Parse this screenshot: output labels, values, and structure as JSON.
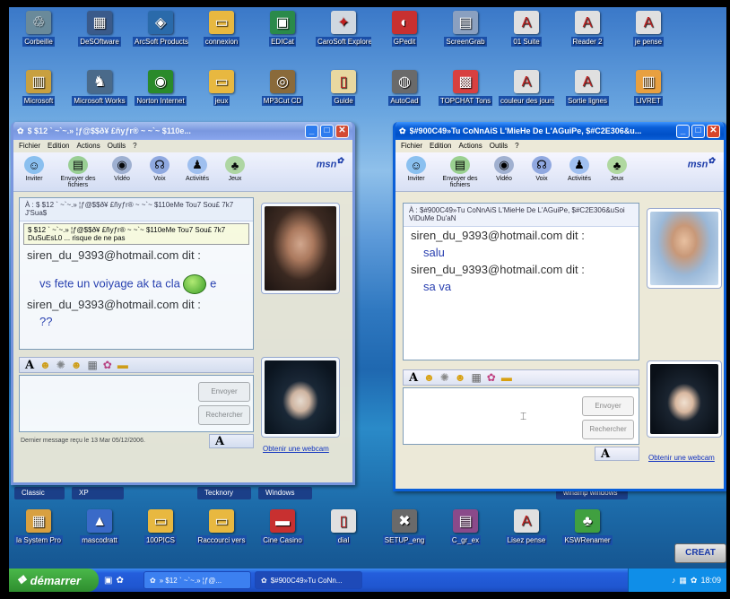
{
  "desktop": {
    "row1": [
      {
        "label": "Corbeille",
        "icon": "recycle-bin-icon",
        "color": "#6a8a9a",
        "glyph": "♲"
      },
      {
        "label": "DeSOftware",
        "icon": "software-icon",
        "color": "#3a5a8a",
        "glyph": "▦"
      },
      {
        "label": "ArcSoft Products",
        "icon": "arcsoft-icon",
        "color": "#2a6aaa",
        "glyph": "◈"
      },
      {
        "label": "connexion",
        "icon": "folder-icon",
        "color": "#e8b840",
        "glyph": "▭"
      },
      {
        "label": "EDICat",
        "icon": "app-icon",
        "color": "#2a8a4a",
        "glyph": "▣"
      },
      {
        "label": "CaroSoft Explorer",
        "icon": "explorer-icon",
        "color": "#d0d8e0",
        "glyph": "✦"
      },
      {
        "label": "GPedit",
        "icon": "gpedit-icon",
        "color": "#c83030",
        "glyph": "◐"
      },
      {
        "label": "ScreenGrab",
        "icon": "screengrab-icon",
        "color": "#8aa0c0",
        "glyph": "▤"
      },
      {
        "label": "01 Suite",
        "icon": "pdf-icon",
        "color": "#e0e0e0",
        "glyph": "A"
      },
      {
        "label": "Reader 2",
        "icon": "pdf-icon",
        "color": "#e0e0e0",
        "glyph": "A"
      },
      {
        "label": "je pense",
        "icon": "pdf-icon",
        "color": "#e0e0e0",
        "glyph": "A"
      }
    ],
    "row2": [
      {
        "label": "Microsoft",
        "icon": "word-icon",
        "color": "#c8a040",
        "glyph": "▥"
      },
      {
        "label": "Microsoft Works",
        "icon": "works-icon",
        "color": "#4a6a8a",
        "glyph": "♞"
      },
      {
        "label": "Norton Internet",
        "icon": "norton-icon",
        "color": "#2a8a2a",
        "glyph": "◉"
      },
      {
        "label": "jeux",
        "icon": "folder-icon",
        "color": "#e8b840",
        "glyph": "▭"
      },
      {
        "label": "MP3Cut CD",
        "icon": "cd-icon",
        "color": "#8a6a3a",
        "glyph": "◎"
      },
      {
        "label": "Guide",
        "icon": "document-icon",
        "color": "#e8d8a0",
        "glyph": "▯"
      },
      {
        "label": "AutoCad",
        "icon": "autocad-icon",
        "color": "#6a6a6a",
        "glyph": "◍"
      },
      {
        "label": "TOPCHAT Tons",
        "icon": "chat-icon",
        "color": "#d84040",
        "glyph": "▩"
      },
      {
        "label": "couleur des jours",
        "icon": "pdf-icon",
        "color": "#e0e0e0",
        "glyph": "A"
      },
      {
        "label": "Sortie lignes",
        "icon": "pdf-icon",
        "color": "#e0e0e0",
        "glyph": "A"
      },
      {
        "label": "LIVRET",
        "icon": "book-icon",
        "color": "#e8a040",
        "glyph": "▥"
      }
    ],
    "bottom_row": [
      {
        "label": "la System Pro",
        "icon": "system-icon",
        "color": "#d8a040",
        "glyph": "▦"
      },
      {
        "label": "mascodratt",
        "icon": "app-icon",
        "color": "#3a6ac8",
        "glyph": "▲"
      },
      {
        "label": "100PICS",
        "icon": "folder-icon",
        "color": "#e8b840",
        "glyph": "▭"
      },
      {
        "label": "Raccourci vers",
        "icon": "folder-icon",
        "color": "#e8b840",
        "glyph": "▭"
      },
      {
        "label": "Cine Casino",
        "icon": "casino-icon",
        "color": "#c83030",
        "glyph": "▬"
      },
      {
        "label": "dial",
        "icon": "document-icon",
        "color": "#e0e0e0",
        "glyph": "▯"
      },
      {
        "label": "SETUP_eng",
        "icon": "setup-icon",
        "color": "#6a6a6a",
        "glyph": "✖"
      },
      {
        "label": "C_gr_ex",
        "icon": "winrar-icon",
        "color": "#8a4a8a",
        "glyph": "▤"
      },
      {
        "label": "Lisez pense",
        "icon": "pdf-icon",
        "color": "#e0e0e0",
        "glyph": "A"
      },
      {
        "label": "KSWRenamer",
        "icon": "renamer-icon",
        "color": "#40a040",
        "glyph": "♣"
      }
    ],
    "quick_bar": [
      "Classic",
      "XP",
      "",
      "Tecknory",
      "Windows"
    ],
    "quick_bar_right": "winamp windows",
    "creat_label": "CREAT"
  },
  "left_window": {
    "title": "$ $12 ` ~`~.» ¦ƒ@$$ð¥ £ñyƒr® ~ ~`~ $110e...",
    "menu": [
      "Fichier",
      "Edition",
      "Actions",
      "Outils",
      "?"
    ],
    "toolbar": [
      "Inviter",
      "Envoyer des fichiers",
      "Vidéo",
      "Voix",
      "Activités",
      "Jeux"
    ],
    "to_line": "À : $ $12 ` ~`~.» ¦ƒ@$$ð¥ £ñyƒr® ~ ~`~ $110eMe Tou7 Sou£ 7k7 J'Sua$",
    "info": "$ $12 ` ~`~.» ¦ƒ@$$ð¥ £ñyƒr® ~ ~`~ $110eMe Tou7 Sou£ 7k7 DuSuEsL0 ... risque de ne pas",
    "messages": [
      {
        "sender": "siren_du_9393@hotmail.com dit :",
        "text": "vs fete un voiyage ak ta cla"
      },
      {
        "sender": "siren_du_9393@hotmail.com dit :",
        "text": "??"
      }
    ],
    "emoticon_tail": "e",
    "send_label": "Envoyer",
    "search_label": "Rechercher",
    "status": "Dernier message reçu le 13 Mar 05/12/2006.",
    "link": "Obtenir une webcam"
  },
  "right_window": {
    "title": "$#900C49»Tu CoNnAiS L'MieHe De L'AGuiPe, $#C2E306&u...",
    "menu": [
      "Fichier",
      "Edition",
      "Actions",
      "Outils",
      "?"
    ],
    "toolbar": [
      "Inviter",
      "Envoyer des fichiers",
      "Vidéo",
      "Voix",
      "Activités",
      "Jeux"
    ],
    "to_line": "À : $#900C49»Tu CoNnAiS L'MieHe De L'AGuiPe, $#C2E306&uSoi ViDuMe Du'aN",
    "messages": [
      {
        "sender": "siren_du_9393@hotmail.com dit :",
        "text": "salu"
      },
      {
        "sender": "siren_du_9393@hotmail.com dit :",
        "text": "sa va"
      }
    ],
    "send_label": "Envoyer",
    "search_label": "Rechercher",
    "link": "Obtenir une webcam"
  },
  "taskbar": {
    "start": "démarrer",
    "tasks": [
      "» $12 ` ~`~.» ¦ƒ@...",
      "$#900C49»Tu CoNn..."
    ],
    "clock": "18:09"
  },
  "colors": {
    "xp_blue": "#0a5fd8",
    "start_green": "#3a9e3a",
    "msn_blue": "#1a3aa8"
  }
}
